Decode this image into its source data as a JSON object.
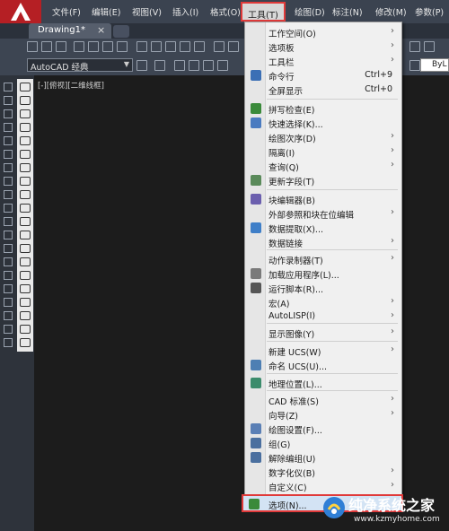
{
  "app": {
    "logo": "A"
  },
  "menubar": {
    "items": [
      "文件(F)",
      "编辑(E)",
      "视图(V)",
      "插入(I)",
      "格式(O)",
      "工具(T)",
      "绘图(D)",
      "标注(N)",
      "修改(M)",
      "参数(P)"
    ],
    "active": "工具(T)"
  },
  "tabs": {
    "drawing": "Drawing1*",
    "close": "×"
  },
  "toolbar": {
    "workspace_select": "AutoCAD 经典",
    "layer_value": "ByL"
  },
  "viewport": {
    "label": "[-][俯视][二维线框]"
  },
  "tools_menu": {
    "items": [
      {
        "label": "工作空间(O)",
        "submenu": true
      },
      {
        "label": "选项板",
        "submenu": true
      },
      {
        "label": "工具栏",
        "submenu": true
      },
      {
        "label": "命令行",
        "shortcut": "Ctrl+9",
        "icon": "command-line-icon"
      },
      {
        "label": "全屏显示",
        "shortcut": "Ctrl+0"
      },
      {
        "label": "拼写检查(E)",
        "icon": "spell-check-icon"
      },
      {
        "label": "快速选择(K)...",
        "icon": "quick-select-icon"
      },
      {
        "label": "绘图次序(D)",
        "submenu": true
      },
      {
        "label": "隔离(I)",
        "submenu": true
      },
      {
        "label": "查询(Q)",
        "submenu": true
      },
      {
        "label": "更新字段(T)",
        "icon": "update-field-icon"
      },
      {
        "label": "块编辑器(B)",
        "icon": "block-editor-icon"
      },
      {
        "label": "外部参照和块在位编辑",
        "submenu": true
      },
      {
        "label": "数据提取(X)...",
        "icon": "data-extract-icon"
      },
      {
        "label": "数据链接",
        "submenu": true
      },
      {
        "label": "动作录制器(T)",
        "submenu": true
      },
      {
        "label": "加载应用程序(L)...",
        "icon": "load-app-icon"
      },
      {
        "label": "运行脚本(R)...",
        "icon": "run-script-icon"
      },
      {
        "label": "宏(A)",
        "submenu": true
      },
      {
        "label": "AutoLISP(I)",
        "submenu": true
      },
      {
        "label": "显示图像(Y)",
        "submenu": true
      },
      {
        "label": "新建 UCS(W)",
        "submenu": true
      },
      {
        "label": "命名 UCS(U)...",
        "icon": "named-ucs-icon"
      },
      {
        "label": "地理位置(L)...",
        "icon": "geo-location-icon"
      },
      {
        "label": "CAD 标准(S)",
        "submenu": true
      },
      {
        "label": "向导(Z)",
        "submenu": true
      },
      {
        "label": "绘图设置(F)...",
        "icon": "drafting-settings-icon"
      },
      {
        "label": "组(G)",
        "icon": "group-icon"
      },
      {
        "label": "解除编组(U)",
        "icon": "ungroup-icon"
      },
      {
        "label": "数字化仪(B)",
        "submenu": true
      },
      {
        "label": "自定义(C)",
        "submenu": true
      },
      {
        "label": "选项(N)...",
        "icon": "options-icon",
        "highlighted": true
      }
    ]
  },
  "watermark": {
    "text": "纯净系统之家",
    "url": "www.kzmyhome.com"
  },
  "colors": {
    "highlight_border": "#e03a3a",
    "menubar": "#3b4350",
    "canvas": "#1c1c1c"
  }
}
